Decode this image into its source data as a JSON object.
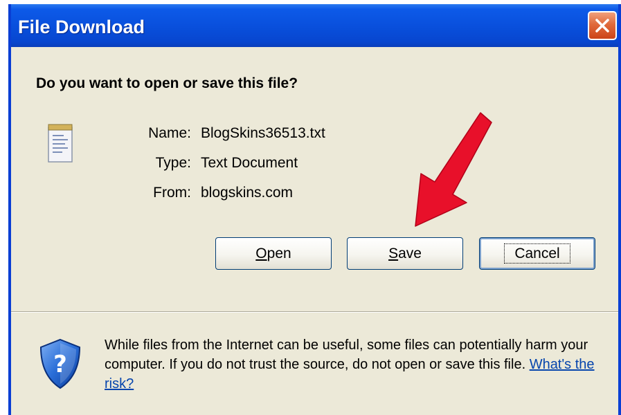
{
  "dialog": {
    "title": "File Download",
    "question": "Do you want to open or save this file?",
    "info": [
      {
        "label": "Name:",
        "value": "BlogSkins36513.txt"
      },
      {
        "label": "Type:",
        "value": "Text Document"
      },
      {
        "label": "From:",
        "value": "blogskins.com"
      }
    ],
    "buttons": {
      "open_prefix": "",
      "open_accel": "O",
      "open_rest": "pen",
      "save_prefix": "",
      "save_accel": "S",
      "save_rest": "ave",
      "cancel_label": "Cancel"
    },
    "warning_text": "While files from the Internet can be useful, some files can potentially harm your computer. If you do not trust the source, do not open or save this file.",
    "risk_link": "What's the risk?"
  },
  "icons": {
    "close": "close-icon",
    "file": "text-file-icon",
    "shield": "security-shield-icon",
    "annotation": "red-arrow"
  },
  "colors": {
    "titlebar": "#0950dd",
    "dialog_bg": "#ece9d8",
    "close_button": "#e06a3c",
    "link": "#0645ad",
    "arrow": "#e8102a"
  }
}
